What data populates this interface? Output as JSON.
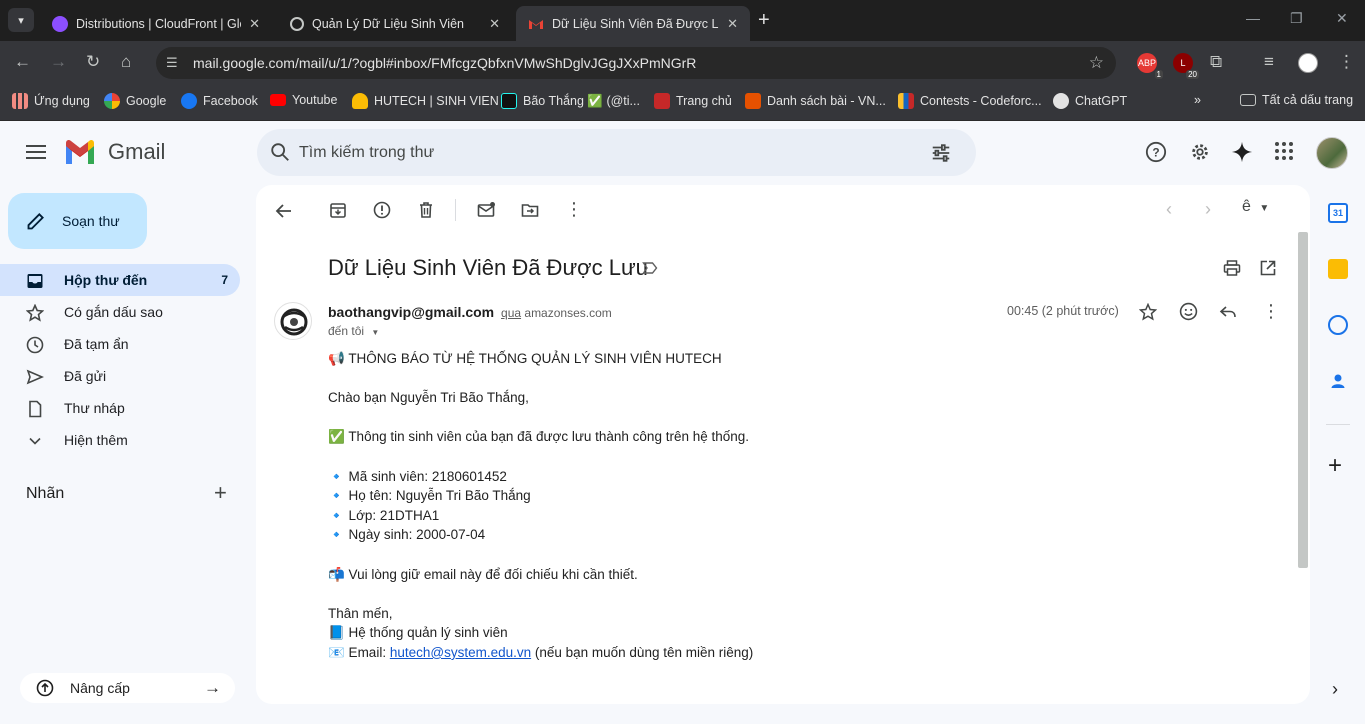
{
  "browser": {
    "tabs": [
      {
        "title": "Distributions | CloudFront | Glob",
        "active": false
      },
      {
        "title": "Quản Lý Dữ Liệu Sinh Viên",
        "active": false
      },
      {
        "title": "Dữ Liệu Sinh Viên Đã Được Lưu",
        "active": true
      }
    ],
    "url": "mail.google.com/mail/u/1/?ogbl#inbox/FMfcgzQbfxnVMwShDglvJGgJXxPmNGrR",
    "extensions": [
      {
        "label": "ABP",
        "badge": "1",
        "color": "#e53935"
      },
      {
        "label": "L",
        "badge": "20",
        "color": "#8b0000"
      }
    ],
    "bookmarks": [
      {
        "label": "Ứng dụng",
        "icon": "apps-grid-icon"
      },
      {
        "label": "Google",
        "icon": "google-icon"
      },
      {
        "label": "Facebook",
        "icon": "facebook-icon"
      },
      {
        "label": "Youtube",
        "icon": "youtube-icon"
      },
      {
        "label": "HUTECH | SINH VIEN",
        "icon": "hutech-icon"
      },
      {
        "label": "Bão Thắng ✅ (@ti...",
        "icon": "tiktok-icon"
      },
      {
        "label": "Trang chủ",
        "icon": "codelearn-icon"
      },
      {
        "label": "Danh sách bài - VN...",
        "icon": "vnoj-icon"
      },
      {
        "label": "Contests - Codeforc...",
        "icon": "codeforces-icon"
      },
      {
        "label": "ChatGPT",
        "icon": "chatgpt-icon"
      }
    ],
    "all_bookmarks": "Tất cả dấu trang"
  },
  "gmail": {
    "brand": "Gmail",
    "search_placeholder": "Tìm kiếm trong thư",
    "compose": "Soạn thư",
    "nav": [
      {
        "label": "Hộp thư đến",
        "count": "7",
        "icon": "inbox-icon",
        "active": true
      },
      {
        "label": "Có gắn dấu sao",
        "count": "",
        "icon": "star-icon",
        "active": false
      },
      {
        "label": "Đã tạm ẩn",
        "count": "",
        "icon": "clock-icon",
        "active": false
      },
      {
        "label": "Đã gửi",
        "count": "",
        "icon": "send-icon",
        "active": false
      },
      {
        "label": "Thư nháp",
        "count": "",
        "icon": "draft-icon",
        "active": false
      },
      {
        "label": "Hiện thêm",
        "count": "",
        "icon": "chevron-down-icon",
        "active": false
      }
    ],
    "labels_header": "Nhãn",
    "upgrade": "Nâng cấp",
    "lang_menu": "ê"
  },
  "email": {
    "subject": "Dữ Liệu Sinh Viên Đã Được Lưu",
    "sender": "baothangvip@gmail.com",
    "via_word": "qua",
    "via_domain": "amazonses.com",
    "to": "đến tôi",
    "time": "00:45 (2 phút trước)",
    "lines": {
      "l1": "📢 THÔNG BÁO TỪ HỆ THỐNG QUẢN LÝ SINH VIÊN HUTECH",
      "l2": "Chào bạn Nguyễn Tri Bão Thắng,",
      "l3": "✅ Thông tin sinh viên của bạn đã được lưu thành công trên hệ thống.",
      "l4": "🔹 Mã sinh viên: 2180601452",
      "l5": "🔹 Họ tên: Nguyễn Tri Bão Thắng",
      "l6": "🔹 Lớp: 21DTHA1",
      "l7": "🔹 Ngày sinh: 2000-07-04",
      "l8": "📬 Vui lòng giữ email này để đối chiếu khi cần thiết.",
      "l9": "Thân mến,",
      "l10": "📘 Hệ thống quản lý sinh viên",
      "l11_prefix": "📧 Email: ",
      "l11_link": "hutech@system.edu.vn",
      "l11_suffix": " (nếu bạn muốn dùng tên miền riêng)"
    }
  }
}
